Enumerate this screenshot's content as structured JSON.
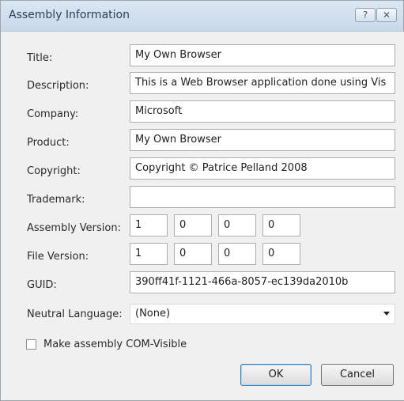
{
  "window": {
    "title": "Assembly Information",
    "help_glyph": "?",
    "close_glyph": "✕"
  },
  "fields": {
    "title": {
      "label": "Title:",
      "value": "My Own Browser"
    },
    "description": {
      "label": "Description:",
      "value": "This is a Web Browser application done using Vis"
    },
    "company": {
      "label": "Company:",
      "value": "Microsoft"
    },
    "product": {
      "label": "Product:",
      "value": "My Own Browser"
    },
    "copyright": {
      "label": "Copyright:",
      "value": "Copyright © Patrice Pelland 2008"
    },
    "trademark": {
      "label": "Trademark:",
      "value": ""
    },
    "assembly_version": {
      "label": "Assembly Version:",
      "parts": [
        "1",
        "0",
        "0",
        "0"
      ]
    },
    "file_version": {
      "label": "File Version:",
      "parts": [
        "1",
        "0",
        "0",
        "0"
      ]
    },
    "guid": {
      "label": "GUID:",
      "value": "390ff41f-1121-466a-8057-ec139da2010b"
    },
    "neutral_language": {
      "label": "Neutral Language:",
      "value": "(None)"
    }
  },
  "com_visible": {
    "label": "Make assembly COM-Visible",
    "checked": false
  },
  "buttons": {
    "ok": "OK",
    "cancel": "Cancel"
  }
}
